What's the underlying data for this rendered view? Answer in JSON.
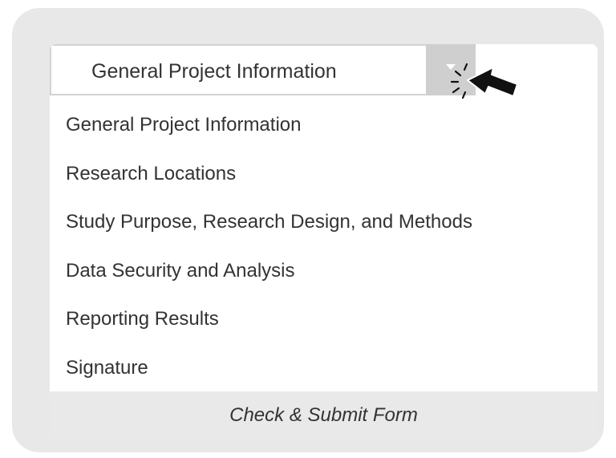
{
  "dropdown": {
    "selected": "General Project Information"
  },
  "menu": {
    "items": [
      "General Project Information",
      "Research Locations",
      "Study Purpose, Research Design, and Methods",
      "Data Security and Analysis",
      "Reporting Results",
      "Signature"
    ]
  },
  "submit": {
    "label": "Check & Submit Form"
  },
  "icons": {
    "dropdown_arrow": "chevron-down-icon",
    "cursor": "mouse-pointer-click-icon"
  },
  "colors": {
    "frame": "#e8e8e8",
    "arrow_bg": "#cfcfcf",
    "submit_bg": "#e9e9e9",
    "text": "#333333"
  }
}
